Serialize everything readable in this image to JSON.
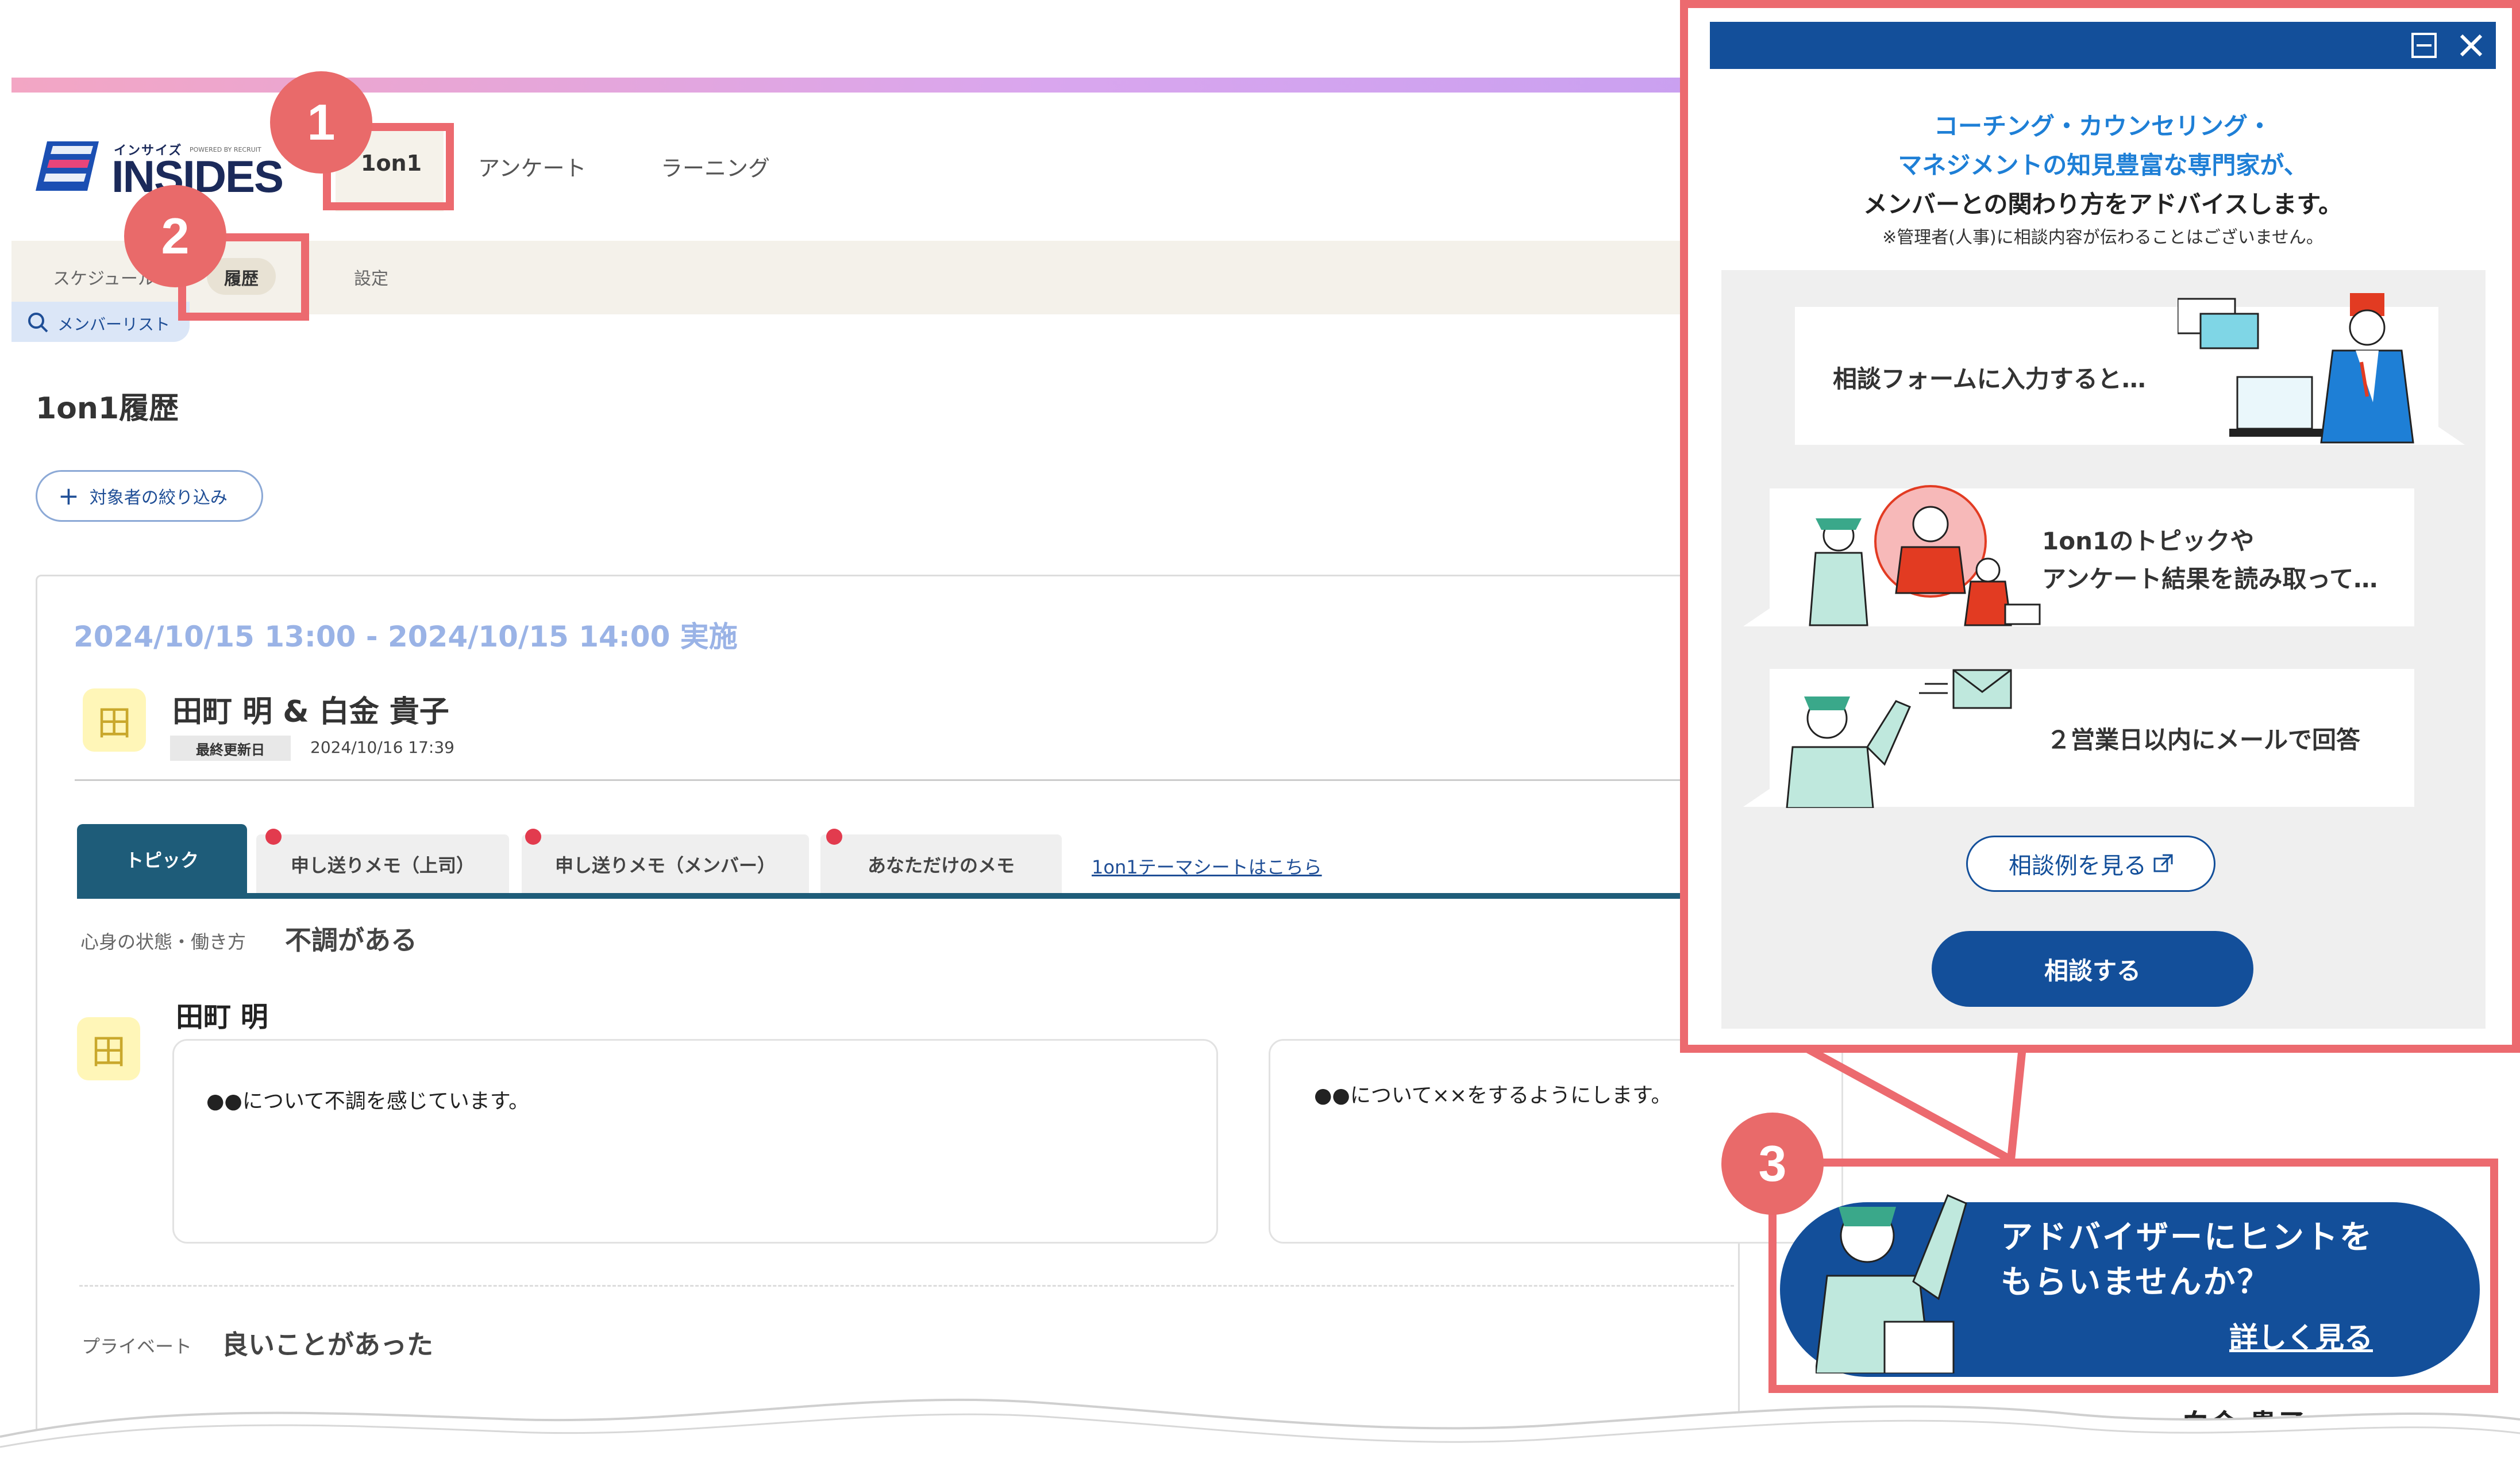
{
  "header": {
    "logo_kana": "インサイズ",
    "logo_word": "INSIDES",
    "logo_sub": "POWERED BY RECRUIT",
    "nav": [
      "1on1",
      "アンケート",
      "ラーニング"
    ]
  },
  "subnav": {
    "items": [
      "スケジュール",
      "履歴",
      "設定"
    ],
    "member_list": "メンバーリスト"
  },
  "page": {
    "title": "1on1履歴",
    "filter_button": "対象者の絞り込み"
  },
  "session": {
    "date_range": "2024/10/15 13:00 - 2024/10/15 14:00 実施",
    "participants": "田町 明 & 白金 貴子",
    "avatar_char": "田",
    "updated_label": "最終更新日",
    "updated_value": "2024/10/16 17:39",
    "tabs": [
      "トピック",
      "申し送りメモ（上司）",
      "申し送りメモ（メンバー）",
      "あなただけのメモ"
    ],
    "sheet_link": "1on1テーマシートはこちら",
    "condition_label": "心身の状態・働き方",
    "condition_value": "不調がある",
    "person1_name": "田町 明",
    "memo_left": "●●について不調を感じています。",
    "memo_right": "●●について××をするようにします。",
    "private_label": "プライベート",
    "private_value": "良いことがあった",
    "person2_name": "白金 貴子"
  },
  "callouts": [
    "1",
    "2",
    "3"
  ],
  "advisor_panel": {
    "intro_line1": "コーチング・カウンセリング・",
    "intro_line2": "マネジメントの知見豊富な専門家が、",
    "intro_line3": "メンバーとの関わり方をアドバイスします。",
    "note": "※管理者(人事)に相談内容が伝わることはございません。",
    "step1": "相談フォームに入力すると…",
    "step2_line1": "1on1のトピックや",
    "step2_line2": "アンケート結果を読み取って…",
    "step3": "２営業日以内にメールで回答",
    "example_button": "相談例を見る",
    "consult_button": "相談する"
  },
  "banner": {
    "line1": "アドバイザーにヒントを",
    "line2": "もらいませんか？",
    "link": "詳しく見る"
  },
  "colors": {
    "accent": "#134f9a",
    "callout": "#ec6a6f",
    "date": "#9ab3e6",
    "tab_active": "#1e5c79"
  }
}
